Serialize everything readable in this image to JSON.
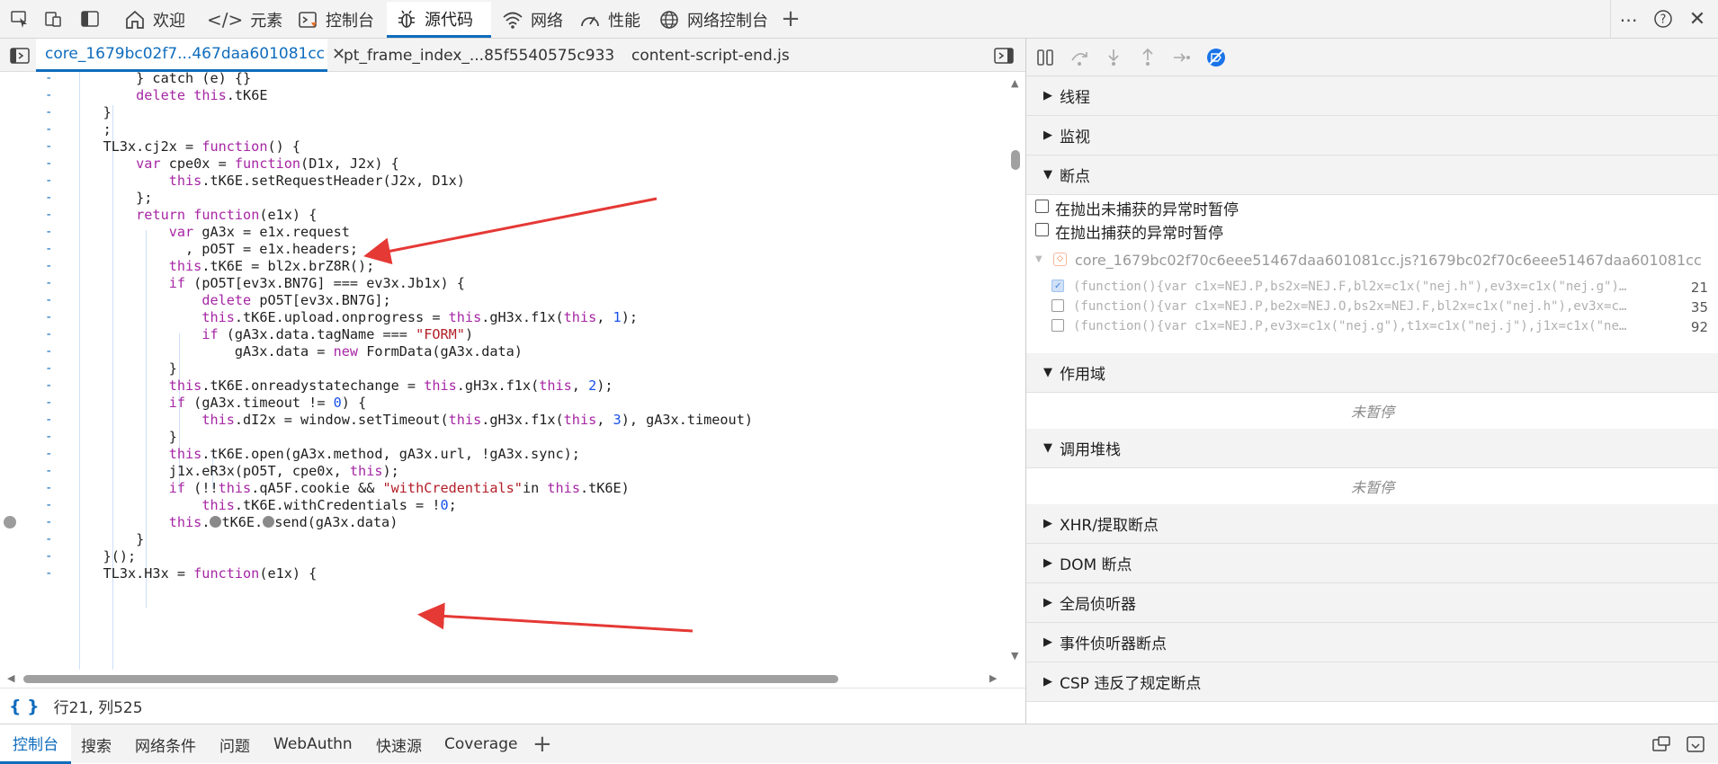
{
  "toolbar": {
    "tabs": [
      {
        "label": "欢迎"
      },
      {
        "label": "元素"
      },
      {
        "label": "控制台"
      },
      {
        "label": "源代码"
      },
      {
        "label": "网络"
      },
      {
        "label": "性能"
      },
      {
        "label": "网络控制台"
      }
    ]
  },
  "editor": {
    "files": [
      {
        "label": "core_1679bc02f7...467daa601081cc"
      },
      {
        "label": "pt_frame_index_...85f5540575c933"
      },
      {
        "label": "content-script-end.js"
      }
    ],
    "status": "行21, 列525",
    "status_icon": "{ }"
  },
  "code_lines": [
    "        } catch (e) {}",
    "        delete this.tK6E",
    "    }",
    "    ;",
    "    TL3x.cj2x = function() {",
    "        var cpe0x = function(D1x, J2x) {",
    "            this.tK6E.setRequestHeader(J2x, D1x)",
    "        };",
    "        return function(e1x) {",
    "            var gA3x = e1x.request",
    "              , pO5T = e1x.headers;",
    "            this.tK6E = bl2x.brZ8R();",
    "            if (pO5T[ev3x.BN7G] === ev3x.Jb1x) {",
    "                delete pO5T[ev3x.BN7G];",
    "                this.tK6E.upload.onprogress = this.gH3x.f1x(this, 1);",
    "                if (gA3x.data.tagName === \"FORM\")",
    "                    gA3x.data = new FormData(gA3x.data)",
    "            }",
    "            this.tK6E.onreadystatechange = this.gH3x.f1x(this, 2);",
    "            if (gA3x.timeout != 0) {",
    "                this.dI2x = window.setTimeout(this.gH3x.f1x(this, 3), gA3x.timeout)",
    "            }",
    "            this.tK6E.open(gA3x.method, gA3x.url, !gA3x.sync);",
    "            j1x.eR3x(pO5T, cpe0x, this);",
    "            if (!!this.qA5F.cookie && \"withCredentials\"in this.tK6E)",
    "                this.tK6E.withCredentials = !0;",
    "            this.●tK6E.●send(gA3x.data)",
    "        }",
    "    }();",
    "    TL3x.H3x = function(e1x) {"
  ],
  "debugger": {
    "sections": {
      "threads": "线程",
      "watch": "监视",
      "breakpoints": "断点",
      "scope": "作用域",
      "callstack": "调用堆栈",
      "xhr": "XHR/提取断点",
      "dom": "DOM 断点",
      "global": "全局侦听器",
      "event": "事件侦听器断点",
      "csp": "CSP 违反了规定断点"
    },
    "pause_uncaught": "在抛出未捕获的异常时暂停",
    "pause_caught": "在抛出捕获的异常时暂停",
    "bp_file": "core_1679bc02f70c6eee51467daa601081cc.js?1679bc02f70c6eee51467daa601081cc",
    "bp_items": [
      {
        "code": "(function(){var c1x=NEJ.P,bs2x=NEJ.F,bl2x=c1x(\"nej.h\"),ev3x=c1x(\"nej.g\")…",
        "line": "21",
        "checked": true
      },
      {
        "code": "(function(){var c1x=NEJ.P,be2x=NEJ.O,bs2x=NEJ.F,bl2x=c1x(\"nej.h\"),ev3x=c…",
        "line": "35",
        "checked": false
      },
      {
        "code": "(function(){var c1x=NEJ.P,ev3x=c1x(\"nej.g\"),t1x=c1x(\"nej.j\"),j1x=c1x(\"ne…",
        "line": "92",
        "checked": false
      }
    ],
    "not_paused": "未暂停"
  },
  "drawer": {
    "tabs": [
      {
        "label": "控制台"
      },
      {
        "label": "搜索"
      },
      {
        "label": "网络条件"
      },
      {
        "label": "问题"
      },
      {
        "label": "WebAuthn"
      },
      {
        "label": "快速源"
      },
      {
        "label": "Coverage"
      }
    ]
  },
  "icons": {
    "inspect": "inspect-icon",
    "device": "device-emulation-icon",
    "dock": "dock-icon",
    "home": "home-icon",
    "elements": "code-brackets-icon",
    "console": "console-icon",
    "sources": "bug-icon",
    "network": "wifi-icon",
    "performance": "gauge-icon",
    "network-console": "globe-icon",
    "add": "plus-icon",
    "more": "more-icon",
    "help": "help-icon",
    "close": "close-icon"
  },
  "colors": {
    "accent": "#0f6cbd",
    "keyword": "#a626a4",
    "string": "#b31d28",
    "number": "#1750eb",
    "annotation": "#e53935"
  }
}
